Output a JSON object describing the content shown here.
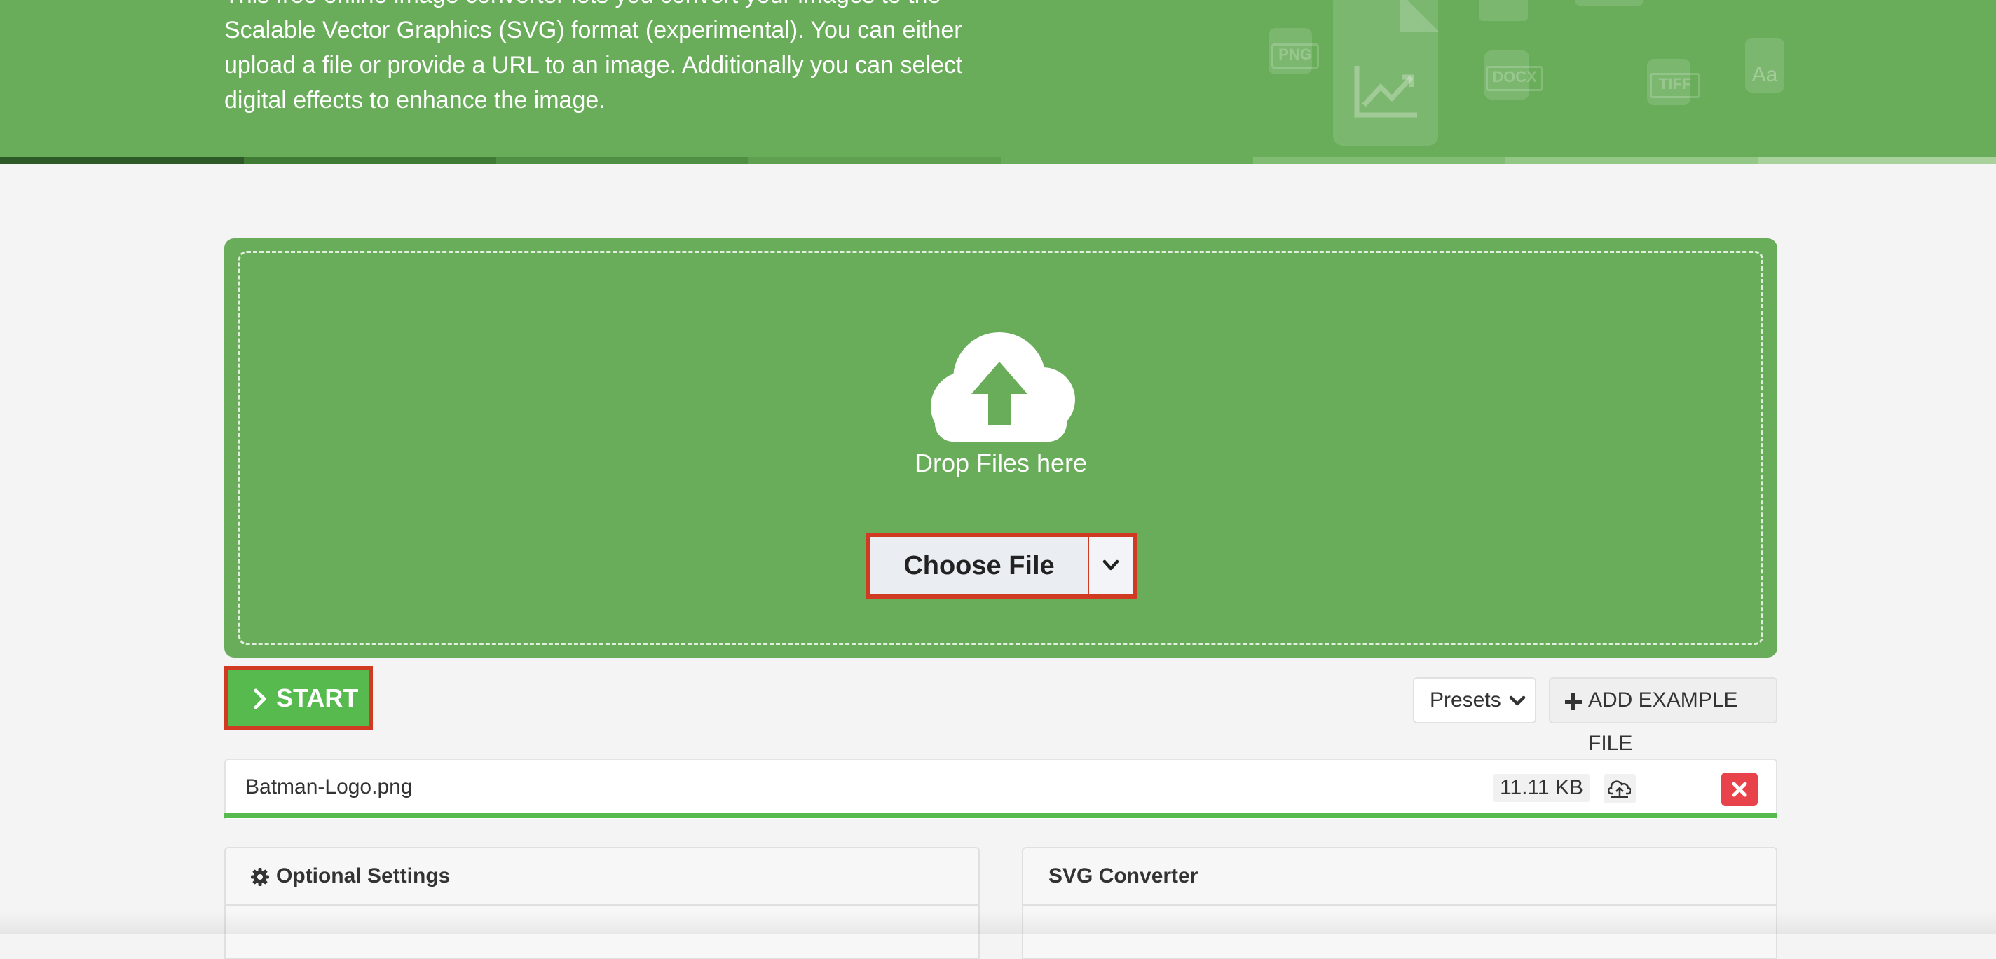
{
  "header": {
    "intro_text": "This free online image converter lets you convert your images to the Scalable Vector Graphics (SVG) format (experimental). You can either upload a file or provide a URL to an image. Additionally you can select digital effects to enhance the image.",
    "decor_formats": [
      "PNG",
      "DOCX",
      "TIFF"
    ],
    "decor_font_glyph": "Aa"
  },
  "dropzone": {
    "icon": "cloud-upload-icon",
    "drop_text": "Drop Files here",
    "choose_label": "Choose File"
  },
  "actions": {
    "start_label": "START",
    "presets_label": "Presets",
    "add_example_label": "ADD EXAMPLE FILE"
  },
  "file": {
    "name": "Batman-Logo.png",
    "size": "11.11 KB",
    "progress": 1.0
  },
  "panels": {
    "optional_settings": "Optional Settings",
    "svg_converter": "SVG Converter"
  },
  "colors": {
    "brand_green": "#69ad5a",
    "start_green": "#56ba4f",
    "highlight_red": "#d13a22",
    "delete_red": "#e8434a"
  }
}
